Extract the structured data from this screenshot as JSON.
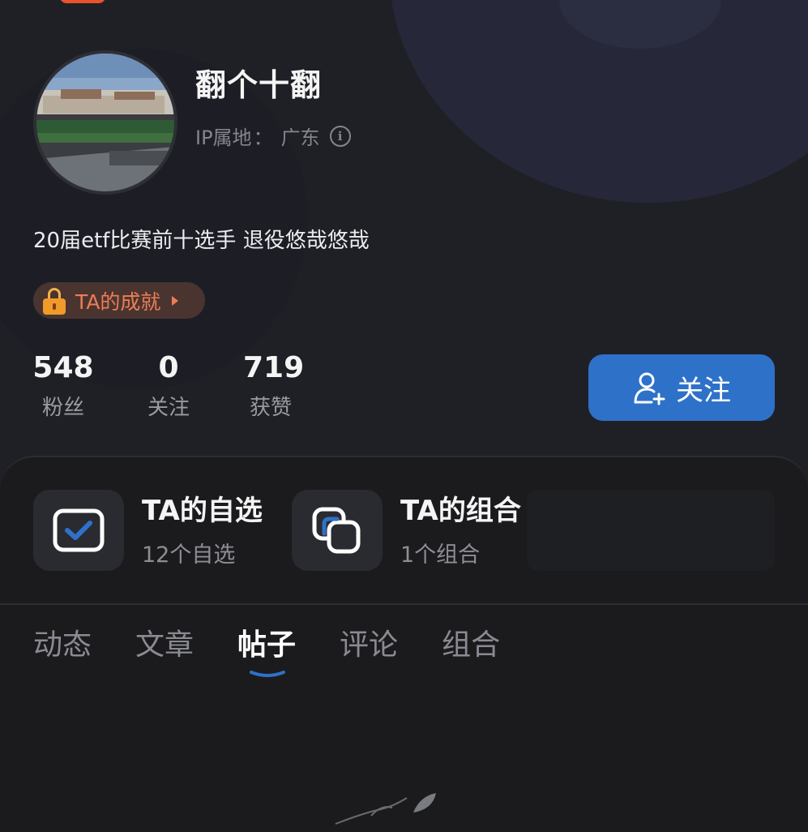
{
  "profile": {
    "username": "翻个十翻",
    "ip_label": "IP属地",
    "ip_sep": "：",
    "ip_value": "广东",
    "bio": "20届etf比赛前十选手 退役悠哉悠哉",
    "achievement_label": "TA的成就"
  },
  "stats": [
    {
      "value": "548",
      "label": "粉丝"
    },
    {
      "value": "0",
      "label": "关注"
    },
    {
      "value": "719",
      "label": "获赞"
    }
  ],
  "follow_button": {
    "label": "关注"
  },
  "cards": [
    {
      "title": "TA的自选",
      "subtitle": "12个自选",
      "icon": "checkbox-icon"
    },
    {
      "title": "TA的组合",
      "subtitle": "1个组合",
      "icon": "overlap-squares-icon"
    }
  ],
  "tabs": [
    {
      "label": "动态",
      "active": false
    },
    {
      "label": "文章",
      "active": false
    },
    {
      "label": "帖子",
      "active": true
    },
    {
      "label": "评论",
      "active": false
    },
    {
      "label": "组合",
      "active": false
    }
  ],
  "colors": {
    "background": "#1b1b1d",
    "header_background": "#1f2025",
    "accent_blue": "#2e71c9",
    "achievement_orange": "#ec7d55",
    "muted_text": "#8a8b92"
  }
}
